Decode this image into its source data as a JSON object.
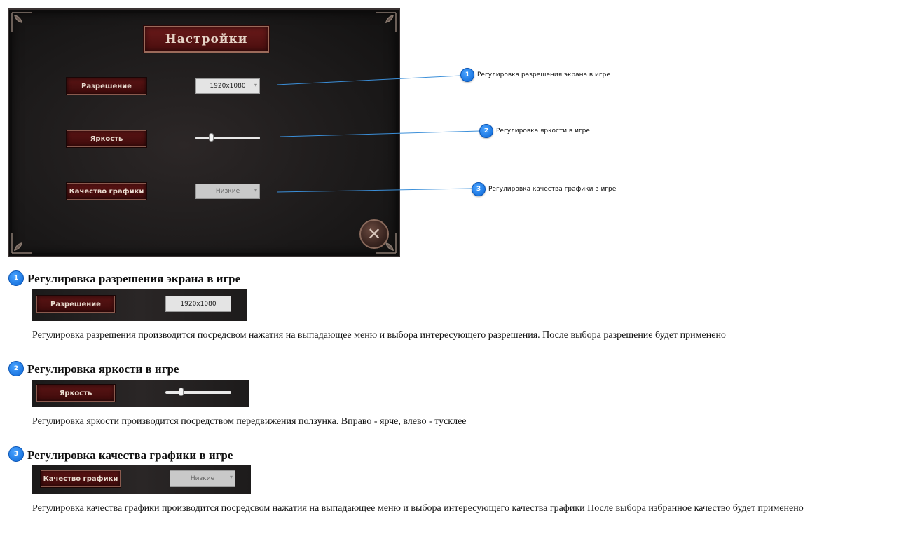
{
  "settings_panel": {
    "title": "Настройки",
    "resolution_label": "Разрешение",
    "resolution_value": "1920x1080",
    "brightness_label": "Яркость",
    "brightness_level": 0.22,
    "quality_label": "Качество графики",
    "quality_value": "Низкие",
    "close_symbol": "✕"
  },
  "callouts": [
    {
      "number": "1",
      "text": "Регулировка разрешения экрана в игре"
    },
    {
      "number": "2",
      "text": "Регулировка яркости в игре"
    },
    {
      "number": "3",
      "text": "Регулировка качества графики в игре"
    }
  ],
  "sections": [
    {
      "number": "1",
      "title": "Регулировка разрешения экрана в игре",
      "button_label": "Разрешение",
      "value": "1920x1080",
      "description": "Регулировка разрешения производится посредсвом нажатия на выпадающее меню и выбора интересующего разрешения. После выбора разрешение будет применено"
    },
    {
      "number": "2",
      "title": "Регулировка яркости в игре",
      "button_label": "Яркость",
      "slider_level": 0.22,
      "description": "Регулировка яркости производится посредством передвижения ползунка. Вправо - ярче, влево - тусклее"
    },
    {
      "number": "3",
      "title": "Регулировка качества графики в игре",
      "button_label": "Качество графики",
      "value": "Низкие",
      "description": "Регулировка качества графики производится посредсвом нажатия на выпадающее меню и выбора интересующего качества графики После выбора избранное качество будет применено"
    }
  ],
  "colors": {
    "badge_blue": "#0a66d6",
    "callout_line": "#3b8fd9",
    "button_red": "#4a0e0e"
  }
}
